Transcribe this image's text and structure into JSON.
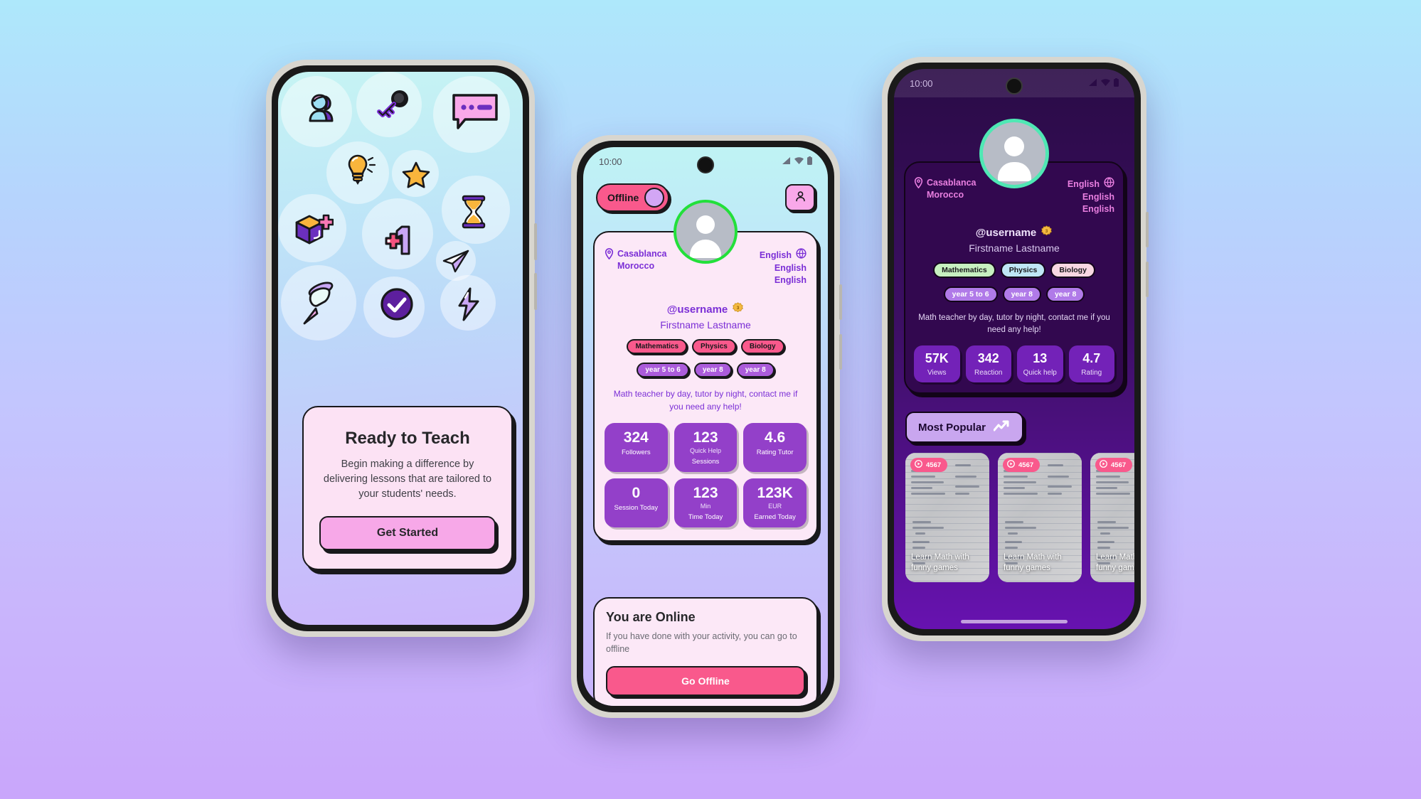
{
  "theme": {
    "page_gradient_top": "#aee8fb",
    "page_gradient_bottom": "#c9a6fb",
    "accent_pink": "#f9598c",
    "accent_purple": "#7b2fd6",
    "dark_purple": "#32084f",
    "online_green": "#22e03a"
  },
  "phone1": {
    "icons": [
      {
        "name": "user-avatar-icon"
      },
      {
        "name": "key-icon"
      },
      {
        "name": "chat-bubble-icon"
      },
      {
        "name": "lightbulb-icon"
      },
      {
        "name": "star-icon"
      },
      {
        "name": "hourglass-icon"
      },
      {
        "name": "cube-plus-icon"
      },
      {
        "name": "plus-one-icon"
      },
      {
        "name": "paper-plane-icon"
      },
      {
        "name": "pushpin-icon"
      },
      {
        "name": "check-circle-icon"
      },
      {
        "name": "lightning-bolt-icon"
      }
    ],
    "card": {
      "title": "Ready to Teach",
      "subtitle": "Begin making a difference by delivering lessons that are tailored to your students' needs.",
      "button_label": "Get Started"
    }
  },
  "phone2": {
    "status_bar": {
      "time": "10:00"
    },
    "toggle": {
      "label": "Offline"
    },
    "profile_button_icon": "person-icon",
    "profile": {
      "location_city": "Casablanca",
      "location_country": "Morocco",
      "languages": [
        "English",
        "English",
        "English"
      ],
      "globe_icon": "globe-icon",
      "username": "@username",
      "badge_icon": "level-badge-icon",
      "badge_value": "3",
      "fullname": "Firstname Lastname",
      "subjects": [
        "Mathematics",
        "Physics",
        "Biology"
      ],
      "years": [
        "year 5 to 6",
        "year 8",
        "year 8"
      ],
      "bio": "Math teacher by day, tutor by night, contact me if you need any help!"
    },
    "stats": [
      {
        "value": "324",
        "unit": "",
        "label": "Followers"
      },
      {
        "value": "123",
        "unit": "Quick Help",
        "label": "Sessions"
      },
      {
        "value": "4.6",
        "unit": "",
        "label": "Rating Tutor"
      },
      {
        "value": "0",
        "unit": "",
        "label": "Session Today"
      },
      {
        "value": "123",
        "unit": "Min",
        "label": "Time Today"
      },
      {
        "value": "123K",
        "unit": "EUR",
        "label": "Earned Today"
      }
    ],
    "online_card": {
      "title": "You are Online",
      "subtitle": "If you have done with your activity, you can go to offline",
      "button_label": "Go Offline"
    }
  },
  "phone3": {
    "status_bar": {
      "time": "10:00"
    },
    "profile": {
      "location_city": "Casablanca",
      "location_country": "Morocco",
      "languages": [
        "English",
        "English",
        "English"
      ],
      "globe_icon": "globe-icon",
      "username": "@username",
      "badge_value": "3",
      "fullname": "Firstname Lastname",
      "subjects": [
        {
          "label": "Mathematics",
          "color": "#c7f0c0"
        },
        {
          "label": "Physics",
          "color": "#bfe6f5"
        },
        {
          "label": "Biology",
          "color": "#f8d7e2"
        }
      ],
      "years": [
        "year 5 to 6",
        "year 8",
        "year 8"
      ],
      "bio": "Math teacher by day, tutor by night, contact me if you need any help!"
    },
    "stats": [
      {
        "value": "57K",
        "label": "Views"
      },
      {
        "value": "342",
        "label": "Reaction"
      },
      {
        "value": "13",
        "label": "Quick help"
      },
      {
        "value": "4.7",
        "label": "Rating"
      }
    ],
    "most_popular": {
      "label": "Most Popular",
      "icon": "trending-up-icon"
    },
    "videos": [
      {
        "plays": "4567",
        "caption": "Learn Math with funny games"
      },
      {
        "plays": "4567",
        "caption": "Learn Math with funny games"
      },
      {
        "plays": "4567",
        "caption": "Learn Math with funny games"
      }
    ]
  }
}
